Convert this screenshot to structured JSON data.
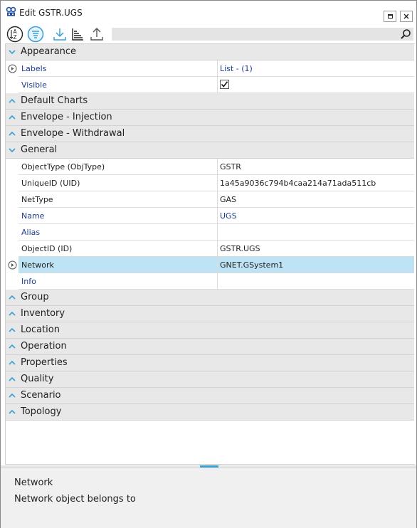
{
  "window": {
    "title": "Edit GSTR.UGS"
  },
  "toolbar": {
    "buttons": [
      {
        "icon": "sort-alphabetical-icon"
      },
      {
        "icon": "categorized-view-icon"
      },
      {
        "icon": "download-icon"
      },
      {
        "icon": "sort-bars-icon"
      },
      {
        "icon": "upload-icon"
      }
    ],
    "search": {
      "value": "",
      "placeholder": ""
    }
  },
  "categories": {
    "appearance": "Appearance",
    "default_charts": "Default Charts",
    "envelope_injection": "Envelope - Injection",
    "envelope_withdrawal": "Envelope - Withdrawal",
    "general": "General",
    "group": "Group",
    "inventory": "Inventory",
    "location": "Location",
    "operation": "Operation",
    "properties": "Properties",
    "quality": "Quality",
    "scenario": "Scenario",
    "topology": "Topology"
  },
  "appearance": {
    "labels": {
      "name": "Labels",
      "value": "List - (1)"
    },
    "visible": {
      "name": "Visible",
      "checked": true
    }
  },
  "general": {
    "object_type": {
      "name": "ObjectType (ObjType)",
      "value": "GSTR"
    },
    "unique_id": {
      "name": "UniqueID (UID)",
      "value": "1a45a9036c794b4caa214a71ada511cb"
    },
    "net_type": {
      "name": "NetType",
      "value": "GAS"
    },
    "name": {
      "name": "Name",
      "value": "UGS"
    },
    "alias": {
      "name": "Alias",
      "value": ""
    },
    "object_id": {
      "name": "ObjectID (ID)",
      "value": "GSTR.UGS"
    },
    "network": {
      "name": "Network",
      "value": "GNET.GSystem1"
    },
    "info": {
      "name": "Info",
      "value": ""
    }
  },
  "description": {
    "title": "Network",
    "text": "Network object belongs to"
  },
  "colors": {
    "accent": "#3aa0d8",
    "selected_row": "#bee3f5",
    "category_bg": "#e8e8e8",
    "link_text": "#1a3c8c"
  }
}
